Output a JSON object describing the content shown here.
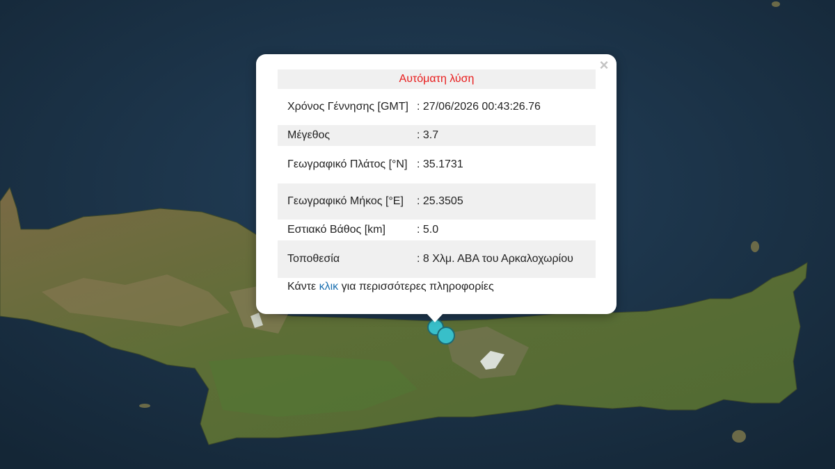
{
  "popup": {
    "title": "Αυτόματη λύση",
    "close_label": "×",
    "rows": [
      {
        "label": "Χρόνος Γέννησης [GMT]",
        "value": ": 27/06/2026 00:43:26.76"
      },
      {
        "label": "Μέγεθος",
        "value": ": 3.7"
      },
      {
        "label": "Γεωγραφικό Πλάτος [°N]",
        "value": ": 35.1731"
      },
      {
        "label": "Γεωγραφικό Μήκος [°E]",
        "value": ": 25.3505"
      },
      {
        "label": "Εστιακό Βάθος [km]",
        "value": ": 5.0"
      },
      {
        "label": "Τοποθεσία",
        "value": ": 8 Χλμ. ΑΒΑ του Αρκαλοχωρίου"
      }
    ],
    "footer_prefix": "Κάντε ",
    "footer_link": "κλικ",
    "footer_suffix": " για περισσότερες πληροφορίες"
  },
  "colors": {
    "title": "#e81a1a",
    "link": "#1a6fb0",
    "marker_fill": "#38bfc9",
    "sea": "#1f3a4f",
    "land": "#5a6b35"
  },
  "markers": [
    {
      "name": "epicenter-marker-1"
    },
    {
      "name": "epicenter-marker-2"
    }
  ]
}
